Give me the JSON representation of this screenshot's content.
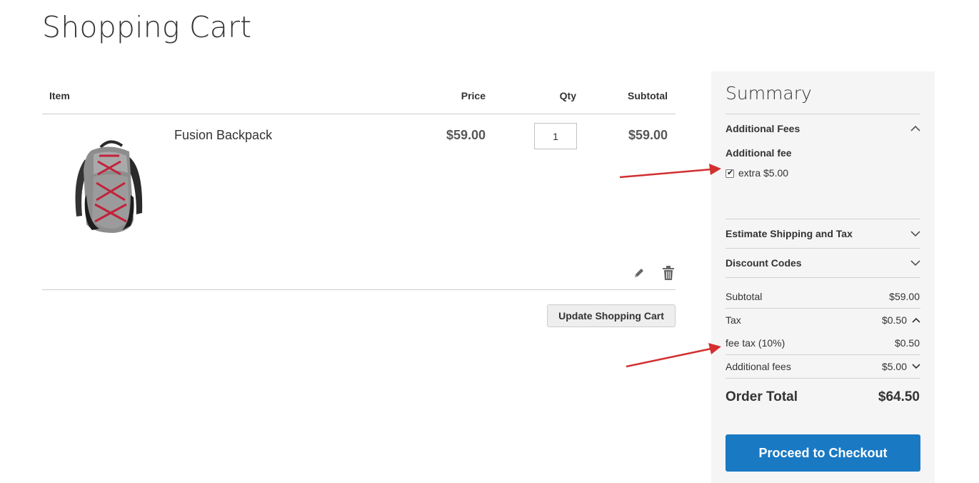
{
  "page": {
    "title": "Shopping Cart"
  },
  "cart": {
    "headers": {
      "item": "Item",
      "price": "Price",
      "qty": "Qty",
      "subtotal": "Subtotal"
    },
    "items": [
      {
        "name": "Fusion Backpack",
        "price": "$59.00",
        "qty": "1",
        "subtotal": "$59.00"
      }
    ],
    "update_label": "Update Shopping Cart"
  },
  "summary": {
    "title": "Summary",
    "additional_fees_block": "Additional Fees",
    "fee_heading": "Additional fee",
    "fee_option": {
      "label": "extra $5.00",
      "checked": true
    },
    "estimate_block": "Estimate Shipping and Tax",
    "discount_block": "Discount Codes",
    "totals": {
      "subtotal_label": "Subtotal",
      "subtotal_value": "$59.00",
      "tax_label": "Tax",
      "tax_value": "$0.50",
      "fee_tax_label": "fee tax (10%)",
      "fee_tax_value": "$0.50",
      "additional_fees_label": "Additional fees",
      "additional_fees_value": "$5.00",
      "order_total_label": "Order Total",
      "order_total_value": "$64.50"
    },
    "checkout_label": "Proceed to Checkout"
  },
  "colors": {
    "primary_button": "#1979c3",
    "annotation_arrow": "#d32f2f",
    "summary_bg": "#f5f5f5"
  },
  "icons": [
    "pencil-icon",
    "trash-icon",
    "chevron-up-icon",
    "chevron-down-icon",
    "checkmark-icon"
  ]
}
